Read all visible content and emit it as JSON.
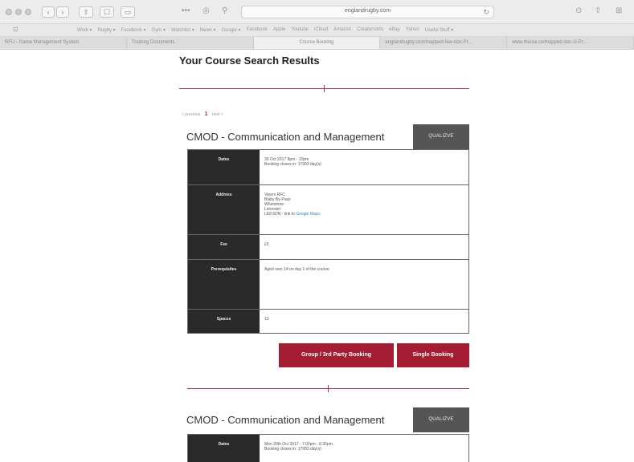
{
  "browser": {
    "url": "englandrugby.com",
    "bookmarks": [
      "Work ▾",
      "Rugby ▾",
      "Facebook ▾",
      "Gym ▾",
      "Watchlist ▾",
      "News ▾",
      "Google ▾",
      "Facebook",
      "Apple",
      "Youtube",
      "iCloud",
      "Amazon",
      "CreatorsInfo",
      "eBay",
      "Yahoo",
      "Useful Stuff ▾"
    ],
    "tabs": [
      "RFU - Game Management System",
      "Training Documents",
      "Course Booking",
      "englandrugby.com/mapped-few-doc-Pr...",
      "www.rfucoa.co/mapped-doc-cl-Pr..."
    ]
  },
  "page": {
    "heading": "Your Course Search Results",
    "pager": {
      "previous": "< previous",
      "current": "1",
      "next": "next >"
    }
  },
  "courses": [
    {
      "title": "CMOD - Communication and Management",
      "badge": "QUALIZVE",
      "dates_label": "Dates",
      "dates_line1": "30 Oct 2017 8pm - 10pm",
      "dates_line2": "Booking closes in: 17993 day(s)",
      "address_label": "Address",
      "address_lines": [
        "Vipers RFC",
        "Blaby By-Pass",
        "Whetstone",
        "Leicester",
        "LE8 6DN - link to"
      ],
      "address_link": "Google Maps.",
      "fee_label": "Fee",
      "fee_value": "£5",
      "prereq_label": "Prerequisites",
      "prereq_value": "Aged over 14 on day 1 of the course",
      "spaces_label": "Spaces",
      "spaces_value": "13",
      "group_button": "Group / 3rd Party Booking",
      "single_button": "Single Booking"
    },
    {
      "title": "CMOD - Communication and Management",
      "badge": "QUALIZVE",
      "dates_label": "Dates",
      "dates_line1": "Mon 30th Oct 2017 - 7.00pm - 8.30pm",
      "dates_line2": "Booking closes in: 17993 day(s)"
    }
  ]
}
